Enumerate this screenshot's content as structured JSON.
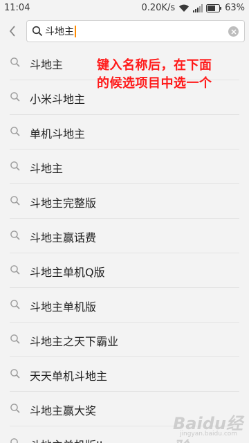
{
  "status_bar": {
    "time": "11:04",
    "speed": "0.20K/s",
    "battery": "63%"
  },
  "search": {
    "value": "斗地主"
  },
  "suggestions": [
    {
      "label": "斗地主"
    },
    {
      "label": "小米斗地主"
    },
    {
      "label": "单机斗地主"
    },
    {
      "label": "斗地主"
    },
    {
      "label": "斗地主完整版"
    },
    {
      "label": "斗地主赢话费"
    },
    {
      "label": "斗地主单机Q版"
    },
    {
      "label": "斗地主单机版"
    },
    {
      "label": "斗地主之天下霸业"
    },
    {
      "label": "天天单机斗地主"
    },
    {
      "label": "斗地主赢大奖"
    },
    {
      "label": "斗地主单机版II"
    }
  ],
  "annotation": {
    "line1": "键入名称后，在下面",
    "line2": "的候选项目中选一个"
  },
  "watermark": {
    "text": "Baidu经验",
    "sub": "jingyan.baidu.com"
  },
  "colors": {
    "annotation": "#ff1a1a",
    "caret": "#ff8a00",
    "background": "#f3f3f3"
  }
}
